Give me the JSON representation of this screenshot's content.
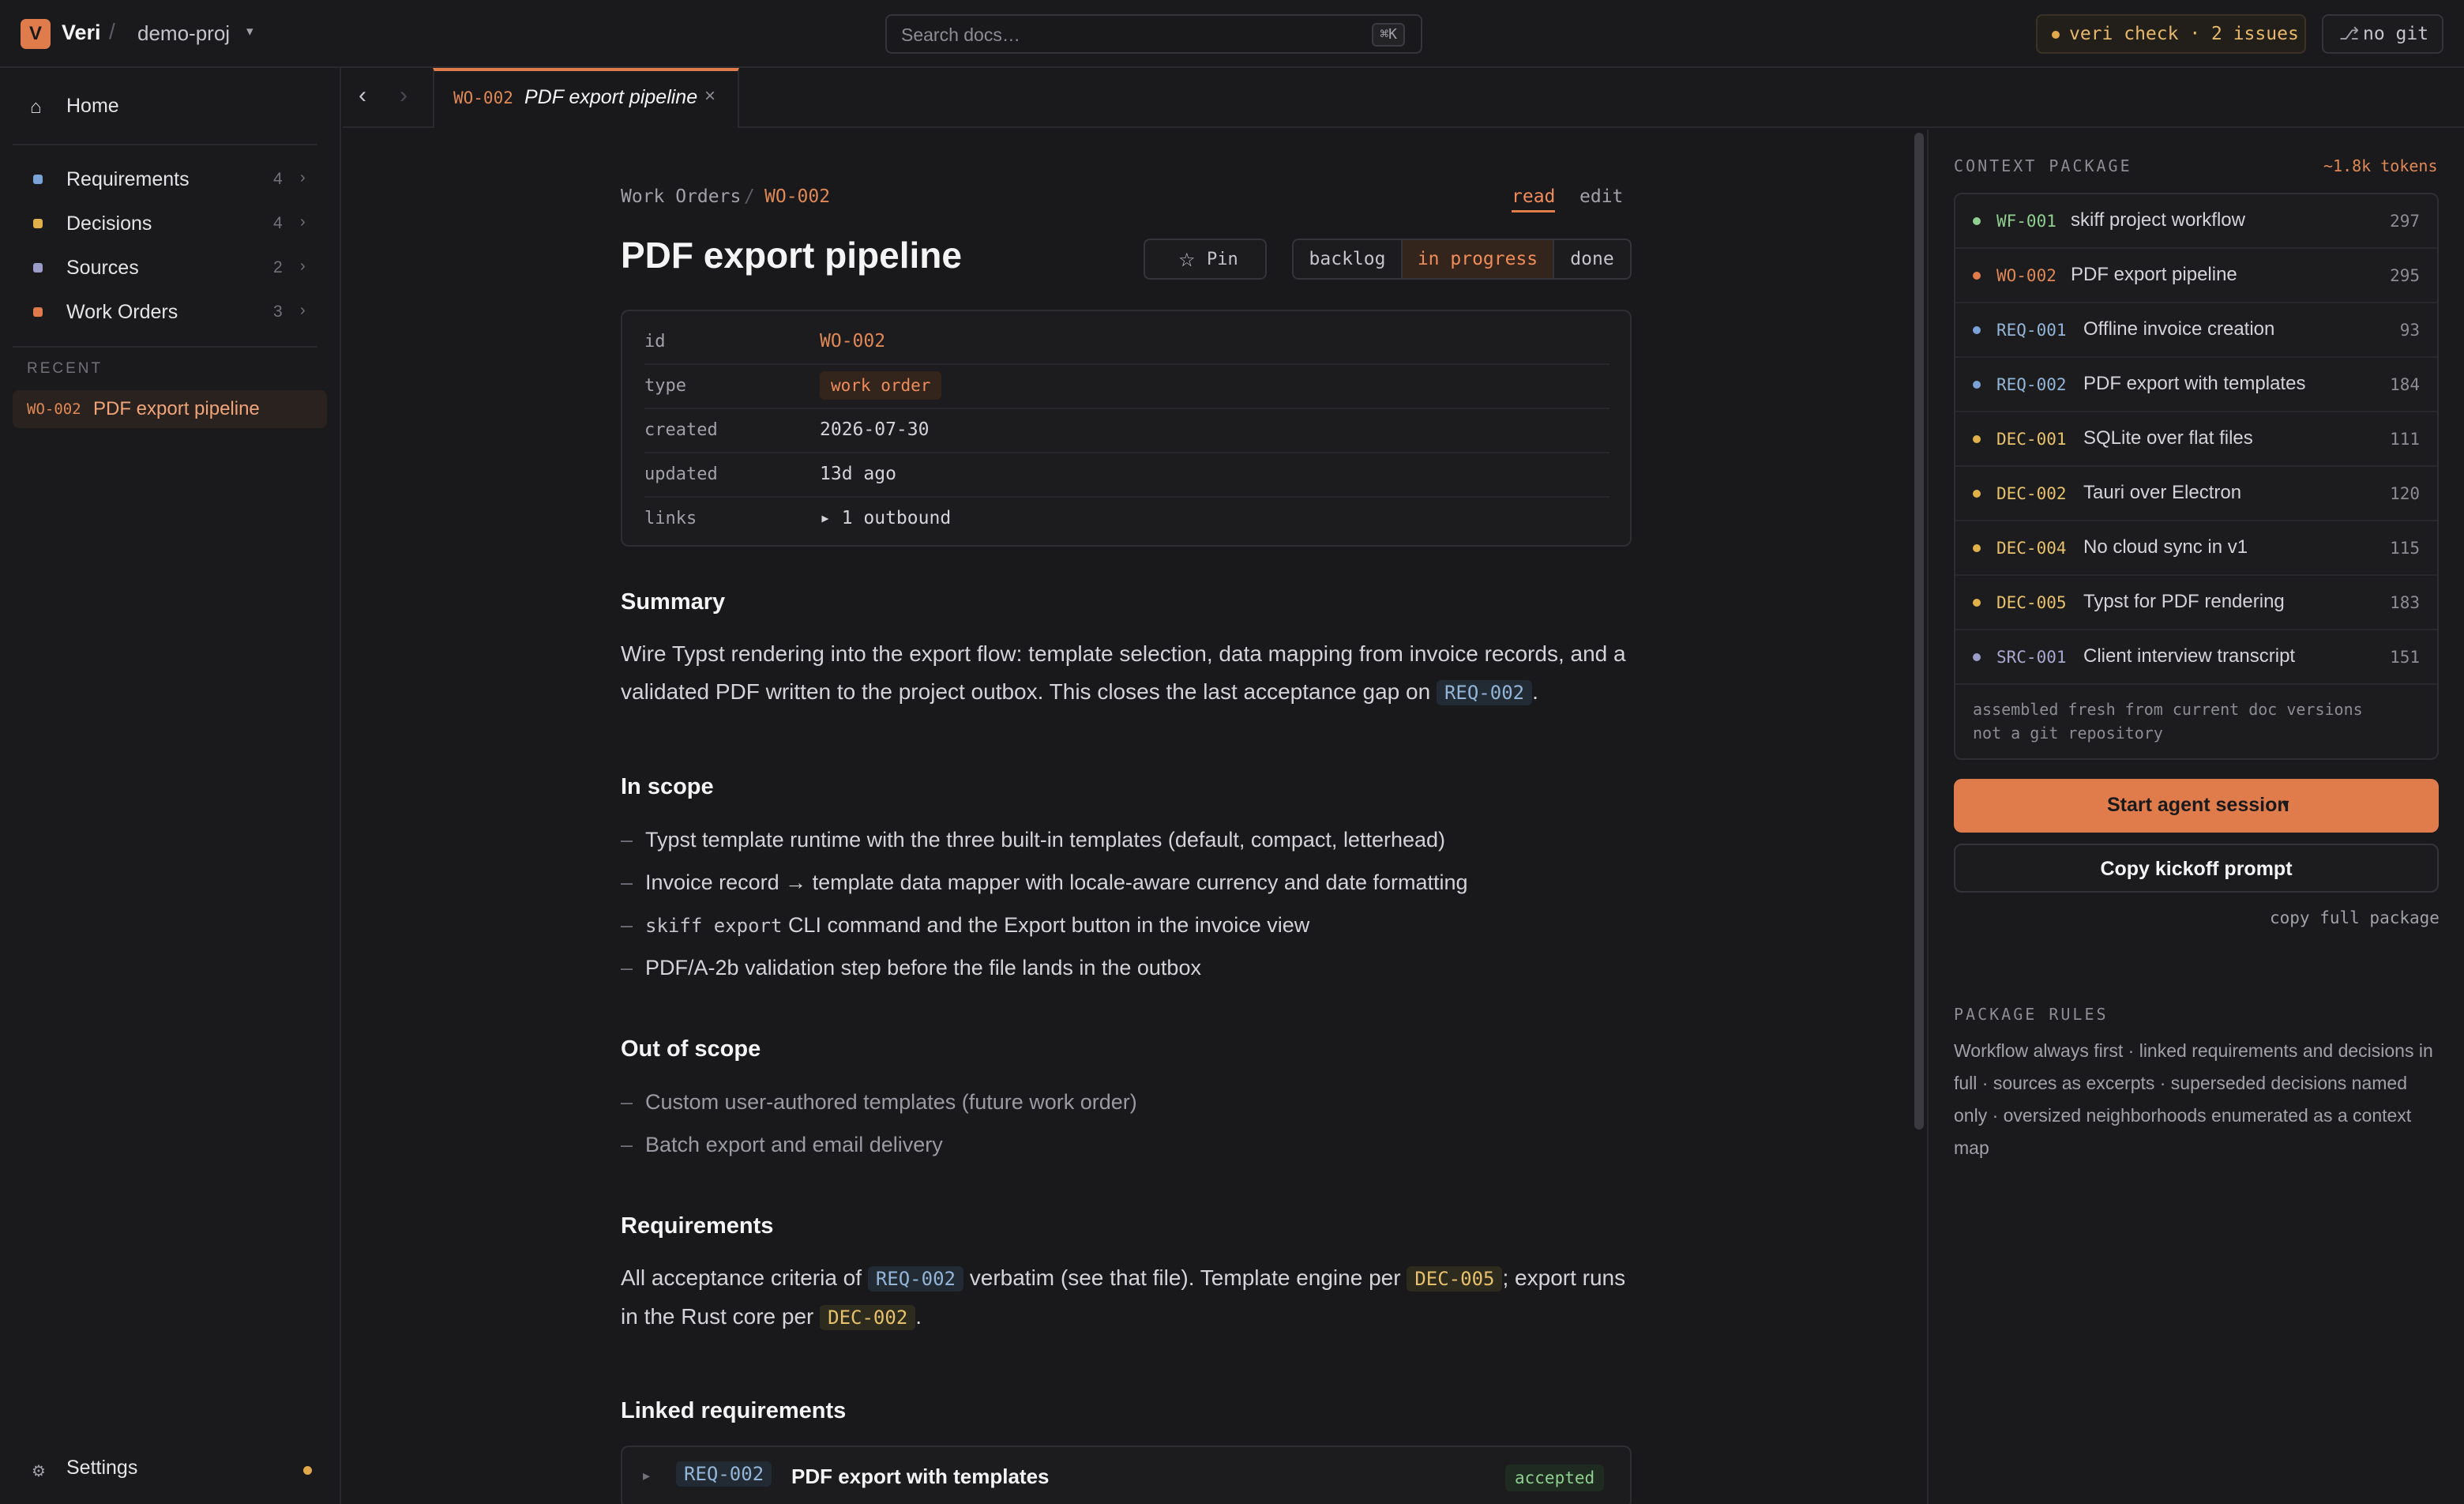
{
  "topbar": {
    "logo_letter": "V",
    "app_name": "Veri",
    "separator": "/",
    "project": "demo-proj",
    "search_placeholder": "Search docs…",
    "search_shortcut": "⌘K",
    "check_status": "veri check · 2 issues",
    "git_status": "no git"
  },
  "sidebar": {
    "home": "Home",
    "items": [
      {
        "label": "Requirements",
        "count": "4",
        "color": "#7aa2d6"
      },
      {
        "label": "Decisions",
        "count": "4",
        "color": "#e0b14a"
      },
      {
        "label": "Sources",
        "count": "2",
        "color": "#9c9cc8"
      },
      {
        "label": "Work Orders",
        "count": "3",
        "color": "#e07c4c"
      }
    ],
    "recent_label": "RECENT",
    "recent": {
      "id": "WO-002",
      "title": "PDF export pipeline"
    },
    "settings": "Settings"
  },
  "tab": {
    "id": "WO-002",
    "title": "PDF export pipeline",
    "close": "×"
  },
  "doc": {
    "breadcrumb_parent": "Work Orders",
    "breadcrumb_sep": "/",
    "breadcrumb_current": "WO-002",
    "mode_read": "read",
    "mode_edit": "edit",
    "title": "PDF export pipeline",
    "pin": "Pin",
    "status_options": [
      "backlog",
      "in progress",
      "done"
    ],
    "status_selected": "in progress",
    "meta": [
      {
        "key": "id",
        "value": "WO-002"
      },
      {
        "key": "type",
        "value": "work order"
      },
      {
        "key": "created",
        "value": "2026-07-30"
      },
      {
        "key": "updated",
        "value": "13d ago"
      },
      {
        "key": "links",
        "value": "▸ 1 outbound"
      }
    ],
    "summary_heading": "Summary",
    "summary_text": "Wire Typst rendering into the export flow: template selection, data mapping from invoice records, and a validated PDF written to the project outbox. This closes the last acceptance gap on",
    "summary_ref": "REQ-002",
    "summary_end": ".",
    "in_scope_heading": "In scope",
    "in_scope": [
      "Typst template runtime with the three built-in templates (default, compact, letterhead)",
      "Invoice record → template data mapper with locale-aware currency and date formatting",
      "CLI command and the Export button in the invoice view",
      "PDF/A-2b validation step before the file lands in the outbox"
    ],
    "in_scope_code": "skiff export",
    "out_scope_heading": "Out of scope",
    "out_scope": [
      "Custom user-authored templates (future work order)",
      "Batch export and email delivery"
    ],
    "req_heading": "Requirements",
    "req_text_1": "All acceptance criteria of",
    "req_ref_1": "REQ-002",
    "req_text_2": "verbatim (see that file). Template engine per",
    "req_ref_2": "DEC-005",
    "req_text_3": "; export runs in the Rust core per",
    "req_ref_3": "DEC-002",
    "req_text_4": ".",
    "linked_heading": "Linked requirements",
    "linked": {
      "id": "REQ-002",
      "title": "PDF export with templates",
      "status": "accepted"
    }
  },
  "context": {
    "heading": "CONTEXT PACKAGE",
    "tokens": "~1.8k tokens",
    "items": [
      {
        "id": "WF-001",
        "title": "skiff project workflow",
        "tokens": "297",
        "color": "#8fcf8f"
      },
      {
        "id": "WO-002",
        "title": "PDF export pipeline",
        "tokens": "295",
        "color": "#e07c4c"
      },
      {
        "id": "REQ-001",
        "title": "Offline invoice creation",
        "tokens": "93",
        "color": "#7aa2d6"
      },
      {
        "id": "REQ-002",
        "title": "PDF export with templates",
        "tokens": "184",
        "color": "#7aa2d6"
      },
      {
        "id": "DEC-001",
        "title": "SQLite over flat files",
        "tokens": "111",
        "color": "#e0b14a"
      },
      {
        "id": "DEC-002",
        "title": "Tauri over Electron",
        "tokens": "120",
        "color": "#e0b14a"
      },
      {
        "id": "DEC-004",
        "title": "No cloud sync in v1",
        "tokens": "115",
        "color": "#e0b14a"
      },
      {
        "id": "DEC-005",
        "title": "Typst for PDF rendering",
        "tokens": "183",
        "color": "#e0b14a"
      },
      {
        "id": "SRC-001",
        "title": "Client interview transcript",
        "tokens": "151",
        "color": "#9c9cc8"
      }
    ],
    "note_1": "assembled fresh from current doc versions",
    "note_2": "not a git repository",
    "start_button": "Start agent session",
    "kickoff_button": "Copy kickoff prompt",
    "copy_full": "copy full package",
    "rules_heading": "PACKAGE RULES",
    "rules_text": "Workflow always first · linked requirements and decisions in full · sources as excerpts · superseded decisions named only · oversized neighborhoods enumerated as a context map"
  }
}
